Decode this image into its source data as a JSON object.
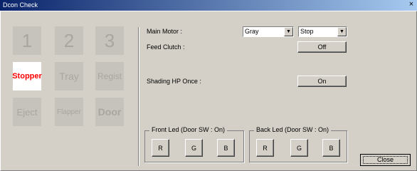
{
  "window": {
    "title": "Dcon Check",
    "close_glyph": "×"
  },
  "tiles": [
    {
      "label": "1"
    },
    {
      "label": "2"
    },
    {
      "label": "3"
    },
    {
      "label": "Stopper"
    },
    {
      "label": "Tray"
    },
    {
      "label": "Regist"
    },
    {
      "label": "Eject"
    },
    {
      "label": "Flapper"
    },
    {
      "label": "Door"
    }
  ],
  "main_motor": {
    "label": "Main Motor :",
    "color_value": "Gray",
    "state_value": "Stop"
  },
  "feed_clutch": {
    "label": "Feed Clutch :",
    "button": "Off"
  },
  "shading": {
    "label": "Shading HP Once :",
    "button": "On"
  },
  "front_led": {
    "title": "Front Led (Door SW : On)",
    "r": "R",
    "g": "G",
    "b": "B"
  },
  "back_led": {
    "title": "Back Led (Door SW : On)",
    "r": "R",
    "g": "G",
    "b": "B"
  },
  "close_button": "Close",
  "colors": {
    "selected_tile_text": "#ff0000",
    "tile_bg": "#c6c3bc",
    "dialog_bg": "#d4d0c8"
  }
}
